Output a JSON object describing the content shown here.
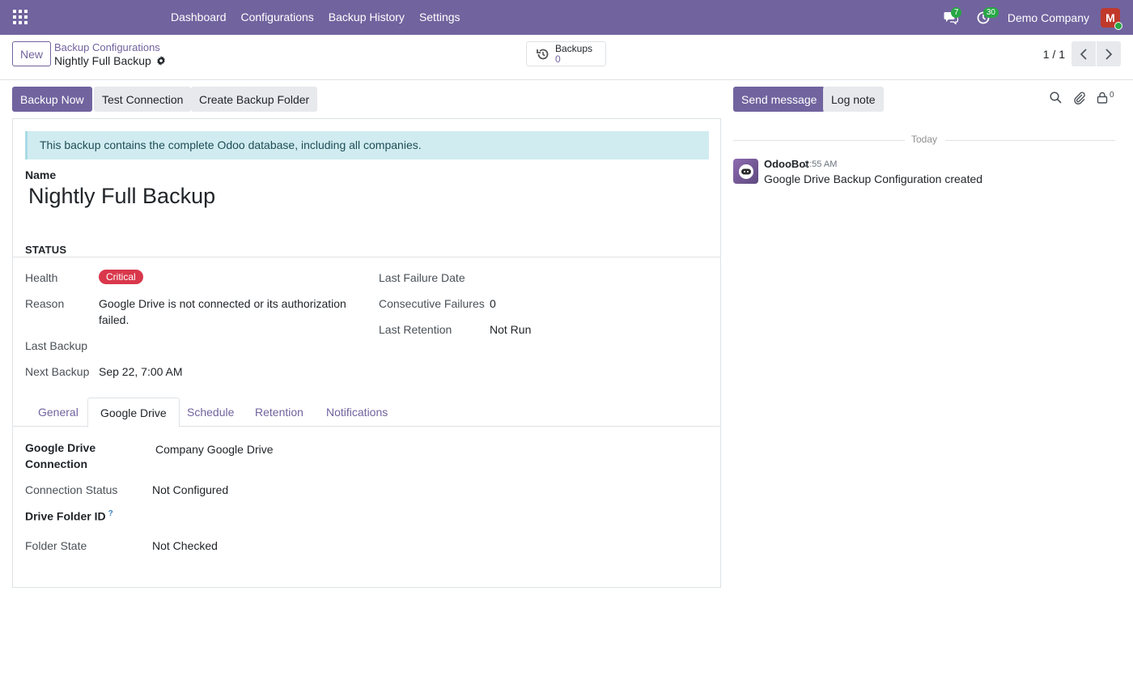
{
  "navbar": {
    "menu": [
      "Dashboard",
      "Configurations",
      "Backup History",
      "Settings"
    ],
    "messages_count": "7",
    "activities_count": "30",
    "company": "Demo Company",
    "avatar_initial": "M"
  },
  "control_panel": {
    "new_label": "New",
    "breadcrumb_parent": "Backup Configurations",
    "breadcrumb_current": "Nightly Full Backup",
    "smart_button": {
      "label": "Backups",
      "value": "0"
    },
    "pager": "1 / 1"
  },
  "actions": {
    "backup_now": "Backup Now",
    "test_connection": "Test Connection",
    "create_folder": "Create Backup Folder"
  },
  "form": {
    "alert": "This backup contains the complete Odoo database, including all companies.",
    "name_label": "Name",
    "name_value": "Nightly Full Backup",
    "status_title": "STATUS",
    "health_label": "Health",
    "health_value": "Critical",
    "reason_label": "Reason",
    "reason_value_1": "Google Drive is not connected or its authorization",
    "reason_value_2": "failed.",
    "last_backup_label": "Last Backup",
    "next_backup_label": "Next Backup",
    "next_backup_value": "Sep 22, 7:00 AM",
    "last_failure_label": "Last Failure Date",
    "consecutive_failures_label": "Consecutive Failures",
    "consecutive_failures_value": "0",
    "last_retention_label": "Last Retention",
    "last_retention_value": "Not Run",
    "tabs": [
      "General",
      "Google Drive",
      "Schedule",
      "Retention",
      "Notifications"
    ],
    "active_tab": "Google Drive",
    "gd_connection_label_1": "Google Drive",
    "gd_connection_label_2": "Connection",
    "gd_connection_value": "Company Google Drive",
    "connection_status_label": "Connection Status",
    "connection_status_value": "Not Configured",
    "drive_folder_label": "Drive Folder ID",
    "drive_folder_help": "?",
    "folder_state_label": "Folder State",
    "folder_state_value": "Not Checked"
  },
  "chatter": {
    "send_message": "Send message",
    "log_note": "Log note",
    "followers_count": "0",
    "date_separator": "Today",
    "message": {
      "author": "OdooBot",
      "time": "2:55 AM",
      "body": "Google Drive Backup Configuration created"
    }
  },
  "colors": {
    "brand": "#71639e",
    "critical": "#d9374b",
    "alert_bg": "#d0ecf1"
  }
}
